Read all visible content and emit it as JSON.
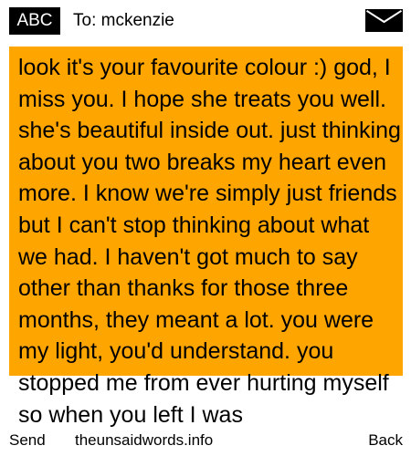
{
  "header": {
    "input_mode": "ABC",
    "recipient_label": "To: mckenzie",
    "envelope_icon": "envelope-icon"
  },
  "message": {
    "background_color": "#ffa500",
    "text_color": "#000000",
    "body": "look it's your favourite colour :) god, I miss you. I hope she treats you well. she's beautiful inside out. just thinking about you two breaks my heart even more. I know we're simply just friends but I can't stop thinking about what we had. I haven't got much to say other than thanks for those three months, they meant a lot. you were my light, you'd understand. you stopped me from ever hurting myself so when you left I was"
  },
  "softkeys": {
    "left": "Send",
    "center": "theunsaidwords.info",
    "right": "Back"
  }
}
